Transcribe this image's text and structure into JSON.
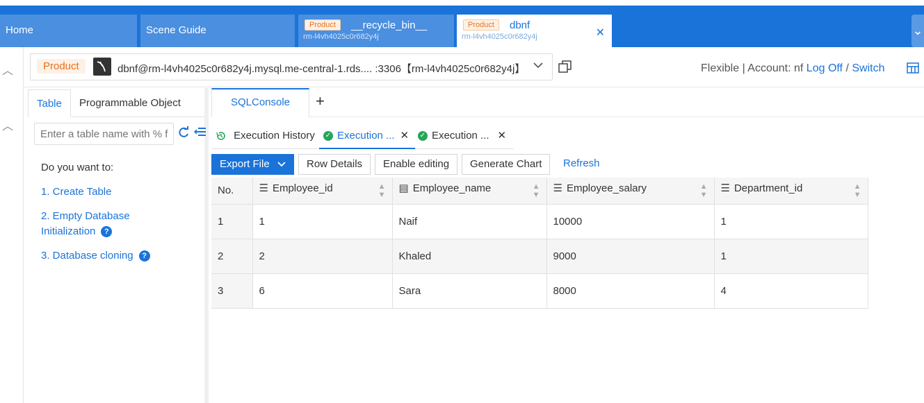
{
  "tabs": {
    "home": "Home",
    "scene_guide": "Scene Guide",
    "recycle": {
      "badge": "Product",
      "name": "__recycle_bin__",
      "sub": "rm-l4vh4025c0r682y4j"
    },
    "dbnf": {
      "badge": "Product",
      "name": "dbnf",
      "sub": "rm-l4vh4025c0r682y4j"
    }
  },
  "connection": {
    "env_badge": "Product",
    "text": "dbnf@rm-l4vh4025c0r682y4j.mysql.me-central-1.rds.... :3306【rm-l4vh4025c0r682y4j】"
  },
  "account": {
    "prefix": "Flexible | Account: nf",
    "logoff": "Log Off",
    "sep": "/",
    "switch": "Switch"
  },
  "sidebar": {
    "tabs": [
      "Table",
      "Programmable Object"
    ],
    "search_placeholder": "Enter a table name with % f",
    "hint_title": "Do you want to:",
    "links": [
      "1.  Create Table",
      "2.  Empty Database Initialization",
      "3.  Database cloning"
    ]
  },
  "console": {
    "tab": "SQLConsole",
    "add": "+",
    "result_tabs": {
      "history": "Execution History",
      "exec1": "Execution ...",
      "exec2": "Execution ..."
    },
    "toolbar": {
      "export": "Export File",
      "row_details": "Row Details",
      "enable_editing": "Enable editing",
      "generate_chart": "Generate Chart",
      "refresh": "Refresh"
    },
    "table": {
      "columns": [
        "No.",
        "Employee_id",
        "Employee_name",
        "Employee_salary",
        "Department_id"
      ],
      "rows": [
        [
          "1",
          "1",
          "Naif",
          "10000",
          "1"
        ],
        [
          "2",
          "2",
          "Khaled",
          "9000",
          "1"
        ],
        [
          "3",
          "6",
          "Sara",
          "8000",
          "4"
        ]
      ]
    }
  },
  "colors": {
    "accent": "#1a73d9",
    "success": "#26a65b",
    "badge_orange": "#e8701a"
  }
}
